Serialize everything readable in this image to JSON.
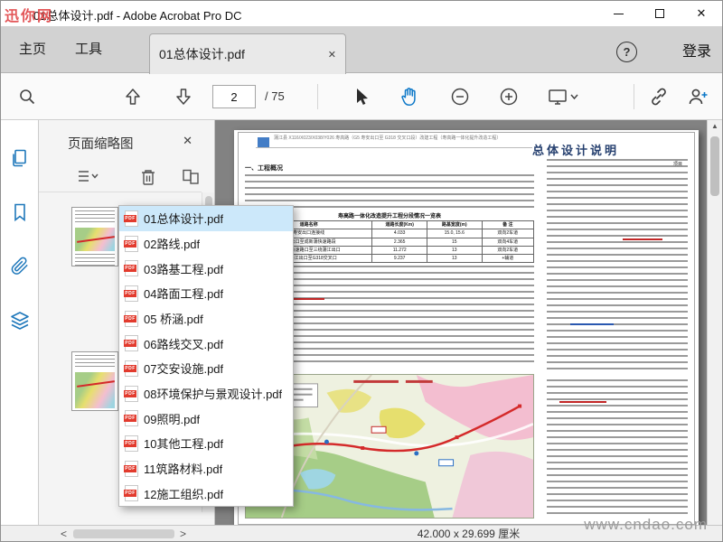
{
  "window": {
    "title": "01总体设计.pdf - Adobe Acrobat Pro DC"
  },
  "watermarks": {
    "top_left": "迅你网",
    "bottom_right": "www.cndao.com"
  },
  "tabbar": {
    "home": "主页",
    "tools": "工具",
    "document_tab": "01总体设计.pdf",
    "sign_in": "登录"
  },
  "toolbar": {
    "page_current": "2",
    "page_total": "/ 75"
  },
  "panel": {
    "title": "页面缩略图"
  },
  "files": [
    {
      "name": "01总体设计.pdf"
    },
    {
      "name": "02路线.pdf"
    },
    {
      "name": "03路基工程.pdf"
    },
    {
      "name": "04路面工程.pdf"
    },
    {
      "name": "05 桥涵.pdf"
    },
    {
      "name": "06路线交叉.pdf"
    },
    {
      "name": "07交安设施.pdf"
    },
    {
      "name": "08环境保护与景观设计.pdf"
    },
    {
      "name": "09照明.pdf"
    },
    {
      "name": "10其他工程.pdf"
    },
    {
      "name": "11筑路材料.pdf"
    },
    {
      "name": "12施工组织.pdf"
    }
  ],
  "doc": {
    "header_line": "蒲江县 X116/X023/X038/Y026 寿高路（G5 寿安出口至 G318 交叉口段）改建工程（寿高路一体化提升改造工程）",
    "title": "总体设计说明",
    "section_1": "一、工程概况",
    "table_title": "寿高路一体化改造提升工程分段情况一览表",
    "table_headers": [
      "道路名称",
      "道路长度(Km)",
      "路基宽度(m)",
      "备 注"
    ],
    "table_rows": [
      [
        "寿安出口连接线",
        "4.033",
        "15.0, 15.6",
        "双向2车道"
      ],
      [
        "寿安出口至成新蒲快速路段",
        "2.365",
        "15",
        "双向4车道"
      ],
      [
        "成新蒲快速路口至三绕蒲江出口",
        "11.272",
        "13",
        "双向2车道"
      ],
      [
        "三绕蒲江出口至G318交叉口",
        "9.237",
        "13",
        "+辅道"
      ]
    ],
    "right_label": "项目"
  },
  "statusbar": {
    "page_size": "42.000 x 29.699 厘米"
  },
  "icons": {
    "close": "✕",
    "help": "?",
    "pdf_label": "PDF",
    "scroll_up": "▲",
    "chevron_down": "⌄",
    "scroll_left": "<",
    "scroll_right": ">"
  }
}
